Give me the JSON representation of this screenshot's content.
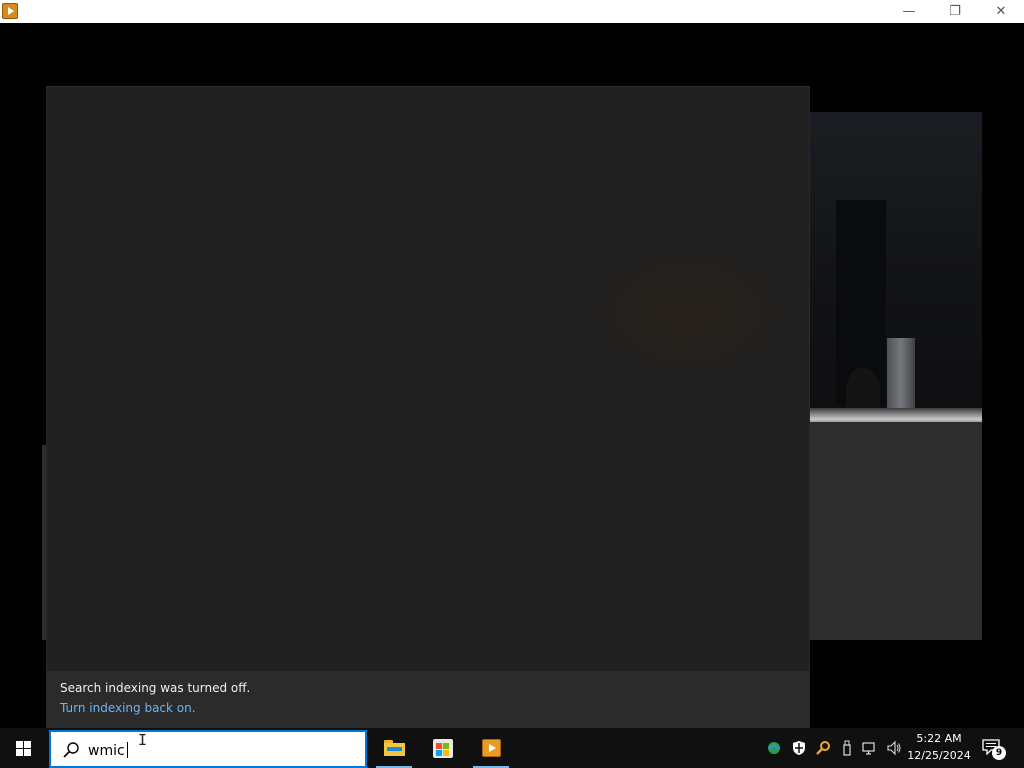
{
  "window": {
    "minimize_glyph": "—",
    "restore_glyph": "❐",
    "close_glyph": "✕"
  },
  "search_panel": {
    "notice_text": "Search indexing was turned off.",
    "notice_link": "Turn indexing back on."
  },
  "taskbar": {
    "search_value": "wmic",
    "pinned_apps": [
      "file-explorer",
      "microsoft-store",
      "media-player"
    ],
    "tray_icons": [
      "network-edge-icon",
      "security-shield-icon",
      "search-tool-icon",
      "usb-device-icon",
      "network-icon",
      "volume-icon"
    ],
    "clock_time": "5:22 AM",
    "clock_date": "12/25/2024",
    "notification_count": "9"
  },
  "colors": {
    "accent": "#0078d7",
    "link": "#6cb4f5",
    "panel": "#202020",
    "taskbar": "#101010"
  }
}
